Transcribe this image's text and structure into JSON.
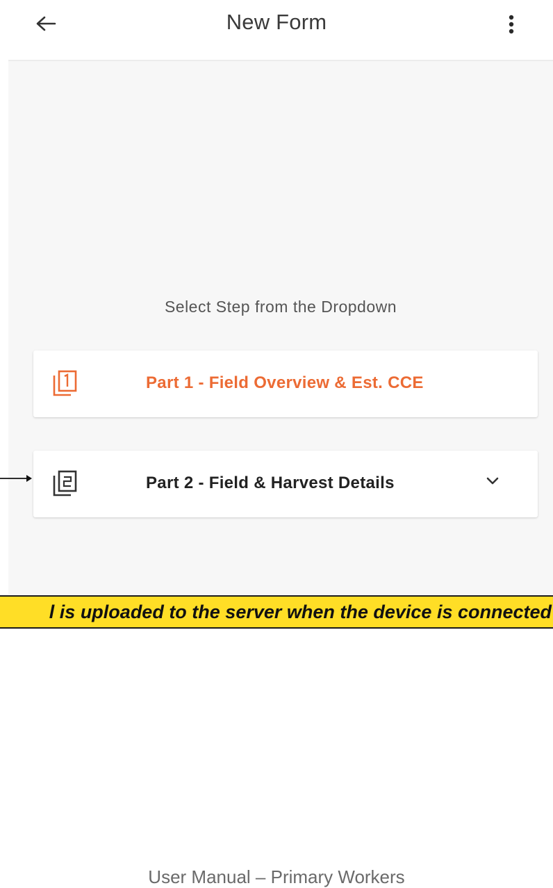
{
  "header": {
    "title": "New Form",
    "back_icon": "arrow-left-icon",
    "menu_icon": "more-vertical-icon"
  },
  "main": {
    "prompt": "Select Step from the Dropdown",
    "steps": [
      {
        "label": "Part 1 - Field Overview & Est. CCE",
        "icon": "step-1-icon",
        "color": "#ec6b34"
      },
      {
        "label": "Part 2 - Field & Harvest Details",
        "icon": "step-2-icon",
        "color": "#222222",
        "expand_icon": "chevron-down-icon"
      }
    ]
  },
  "annotation": {
    "note": "l is uploaded to the server when the device is connected",
    "banner_color": "#ffde26"
  },
  "footer": {
    "text": "User Manual – Primary Workers"
  }
}
